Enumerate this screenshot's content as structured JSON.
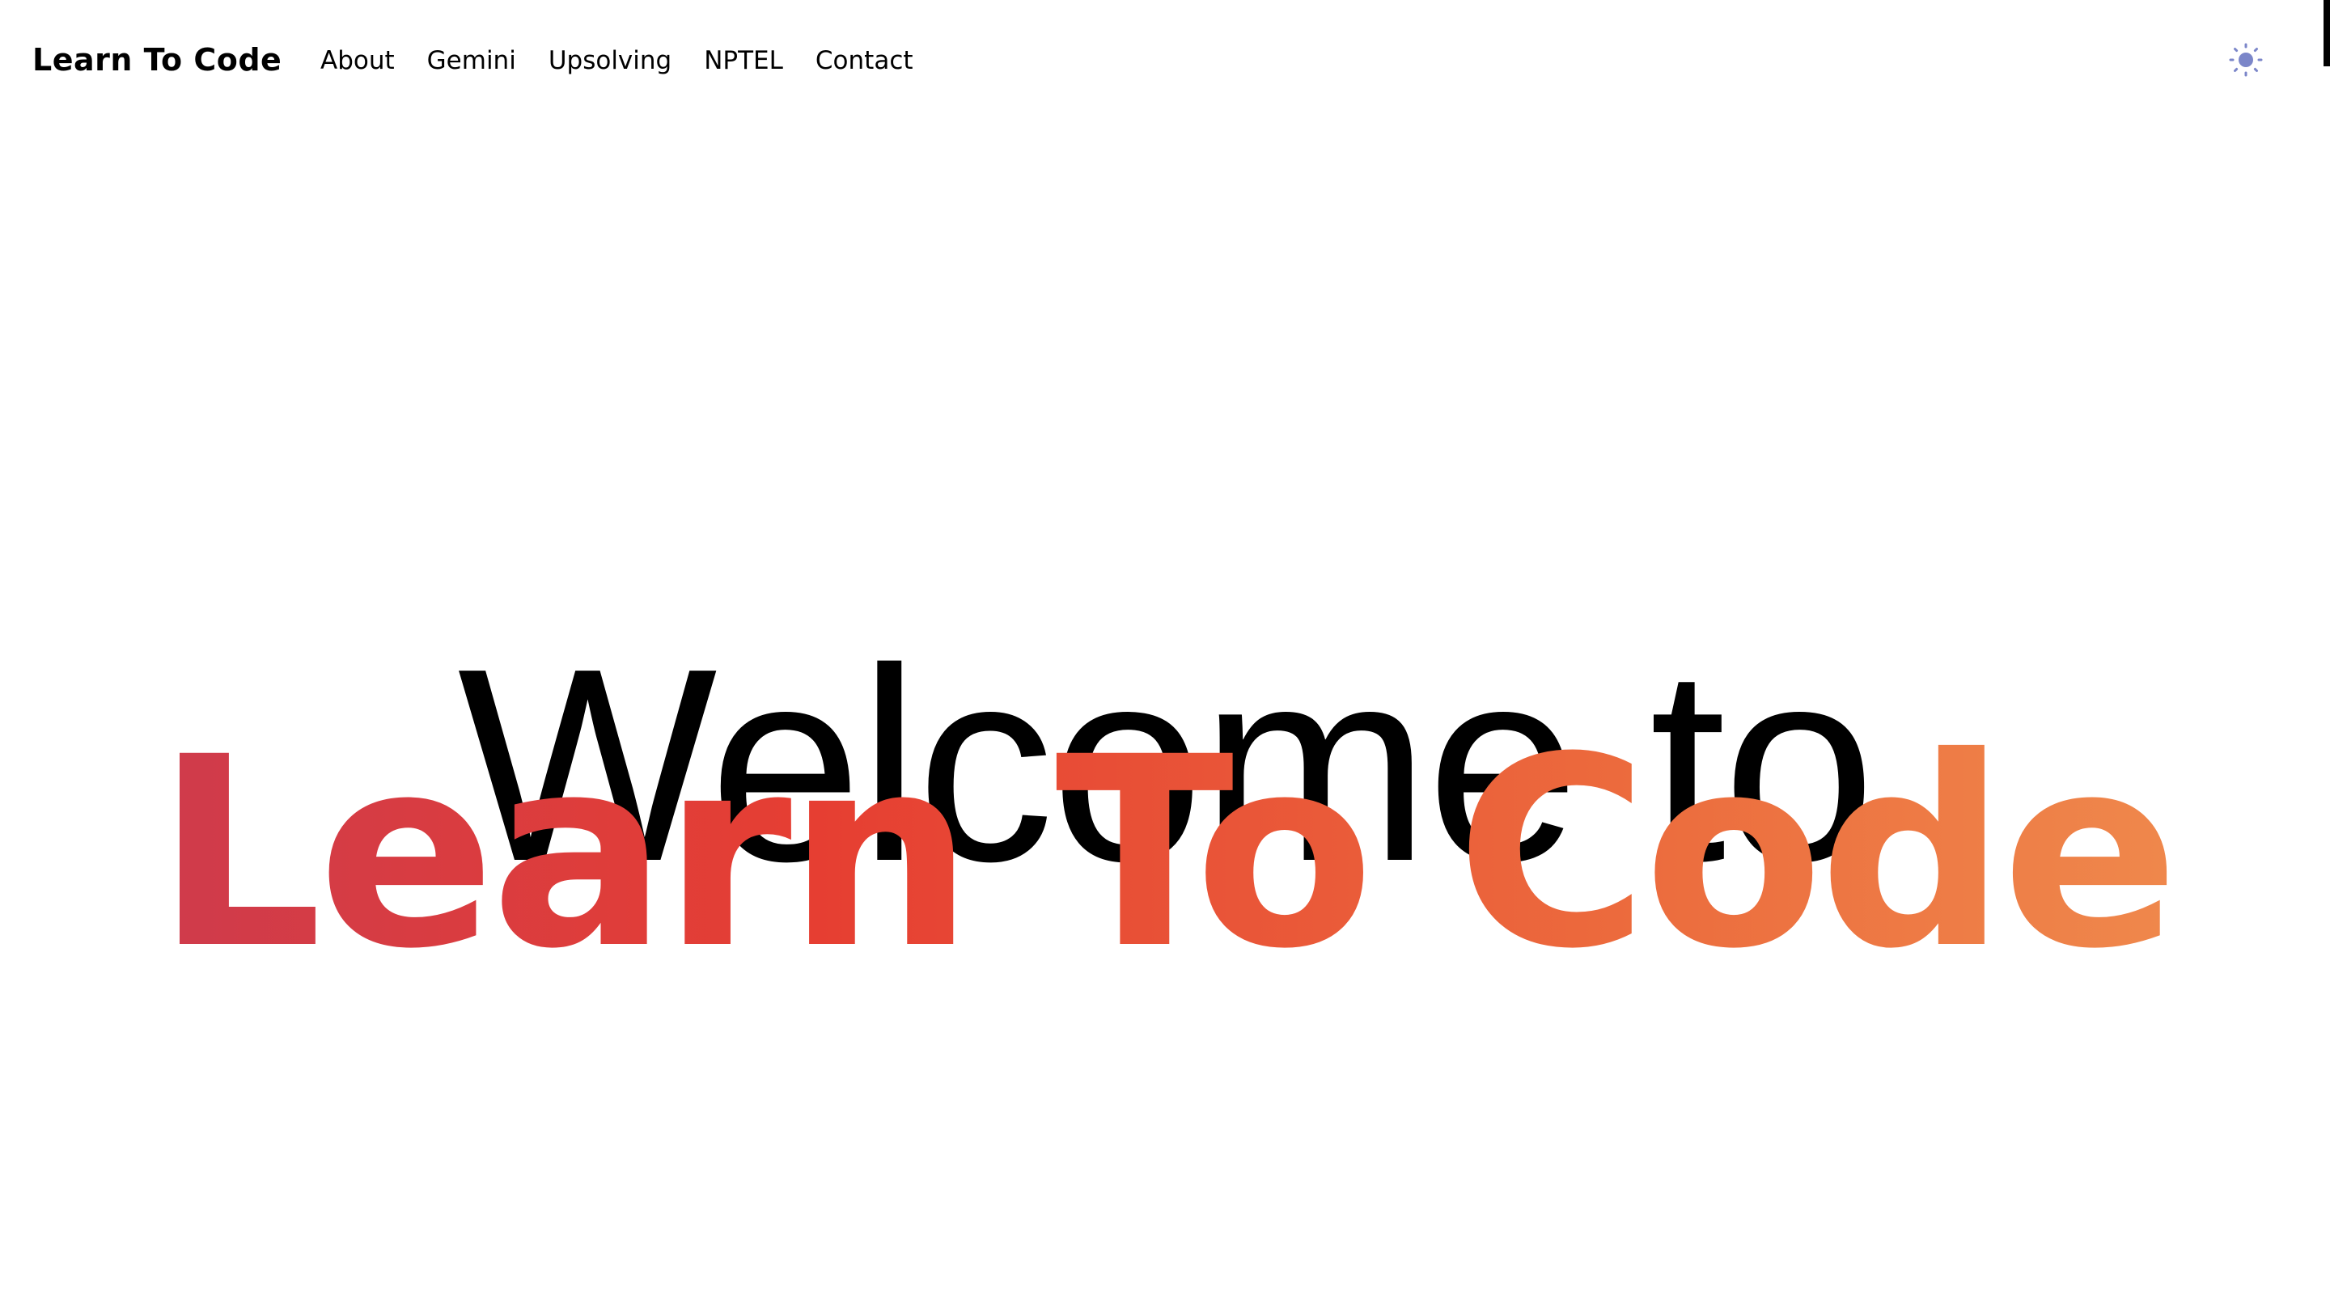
{
  "header": {
    "brand": "Learn To Code",
    "nav": [
      {
        "label": "About"
      },
      {
        "label": "Gemini"
      },
      {
        "label": "Upsolving"
      },
      {
        "label": "NPTEL"
      },
      {
        "label": "Contact"
      }
    ],
    "theme_toggle_icon": "sun-icon"
  },
  "hero": {
    "line1": "Welcome to",
    "line2": "Learn To Code"
  },
  "colors": {
    "gradient_start": "#c93a52",
    "gradient_mid": "#e63e32",
    "gradient_end": "#f09050",
    "sun_icon": "#7b86c9"
  }
}
